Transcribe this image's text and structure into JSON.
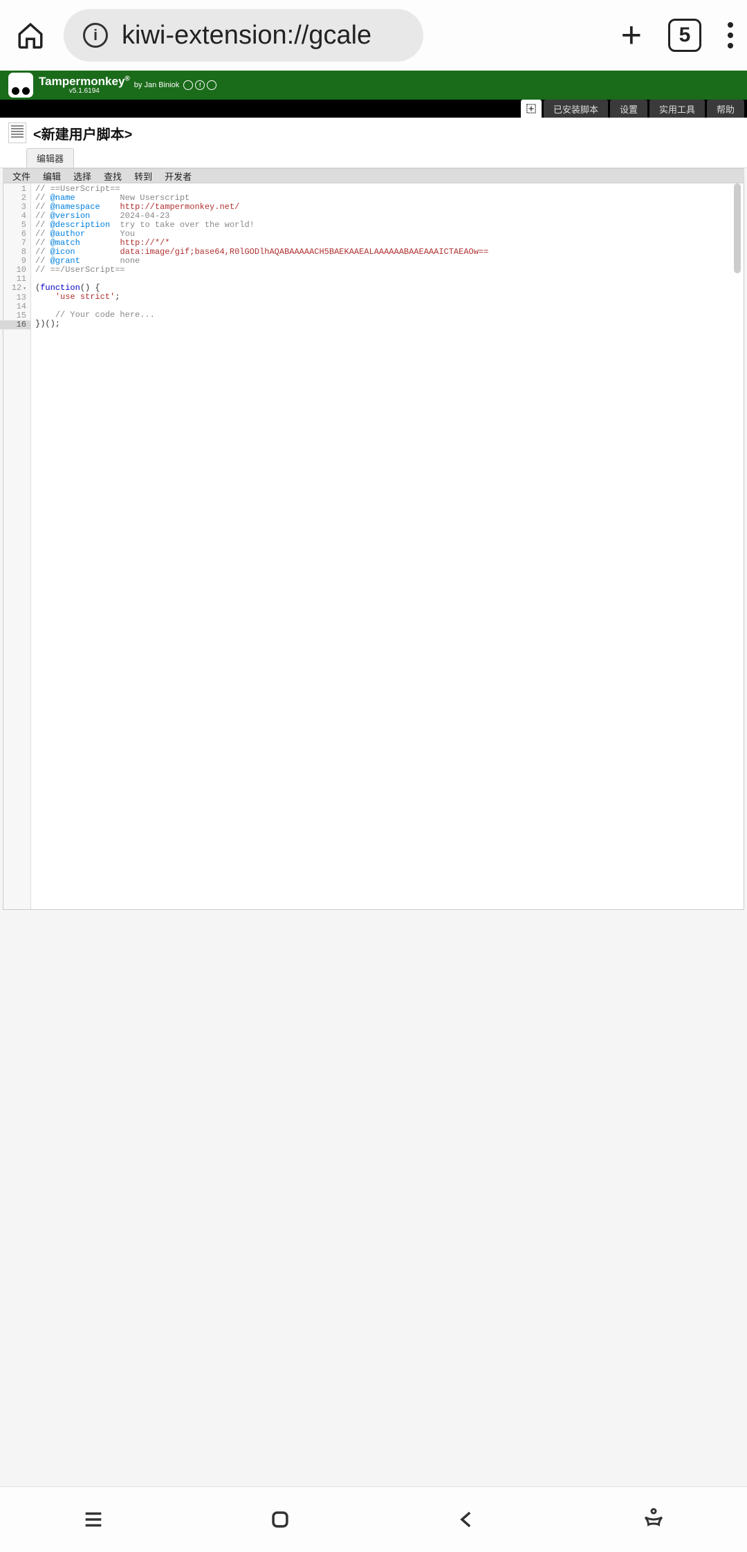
{
  "browser": {
    "url": "kiwi-extension://gcale",
    "tab_count": "5"
  },
  "tm_header": {
    "title": "Tampermonkey",
    "reg": "®",
    "by": "by Jan Biniok",
    "version": "v5.1.6194"
  },
  "nav_tabs": {
    "installed": "已安装脚本",
    "settings": "设置",
    "utilities": "实用工具",
    "help": "帮助"
  },
  "script": {
    "title": "<新建用户脚本>"
  },
  "sub_tab": "编辑器",
  "menu": {
    "file": "文件",
    "edit": "编辑",
    "select": "选择",
    "find": "查找",
    "goto": "转到",
    "developer": "开发者"
  },
  "gutter": [
    "1",
    "2",
    "3",
    "4",
    "5",
    "6",
    "7",
    "8",
    "9",
    "10",
    "11",
    "12",
    "13",
    "14",
    "15",
    "16"
  ],
  "code": {
    "l1_a": "// ==UserScript==",
    "l2_a": "// ",
    "l2_b": "@name",
    "l2_c": "         New Userscript",
    "l3_a": "// ",
    "l3_b": "@namespace",
    "l3_c": "    ",
    "l3_d": "http://tampermonkey.net/",
    "l4_a": "// ",
    "l4_b": "@version",
    "l4_c": "      2024-04-23",
    "l5_a": "// ",
    "l5_b": "@description",
    "l5_c": "  try to take over the world!",
    "l6_a": "// ",
    "l6_b": "@author",
    "l6_c": "       You",
    "l7_a": "// ",
    "l7_b": "@match",
    "l7_c": "        ",
    "l7_d": "http://*/*",
    "l8_a": "// ",
    "l8_b": "@icon",
    "l8_c": "         ",
    "l8_d": "data:image/gif;base64,R0lGODlhAQABAAAAACH5BAEKAAEALAAAAAABAAEAAAICTAEAOw==",
    "l9_a": "// ",
    "l9_b": "@grant",
    "l9_c": "        none",
    "l10_a": "// ==/UserScript==",
    "l12_a": "(",
    "l12_b": "function",
    "l12_c": "() {",
    "l13_a": "    ",
    "l13_b": "'use strict'",
    "l13_c": ";",
    "l15_a": "    ",
    "l15_b": "// Your code here...",
    "l16_a": "})();"
  }
}
